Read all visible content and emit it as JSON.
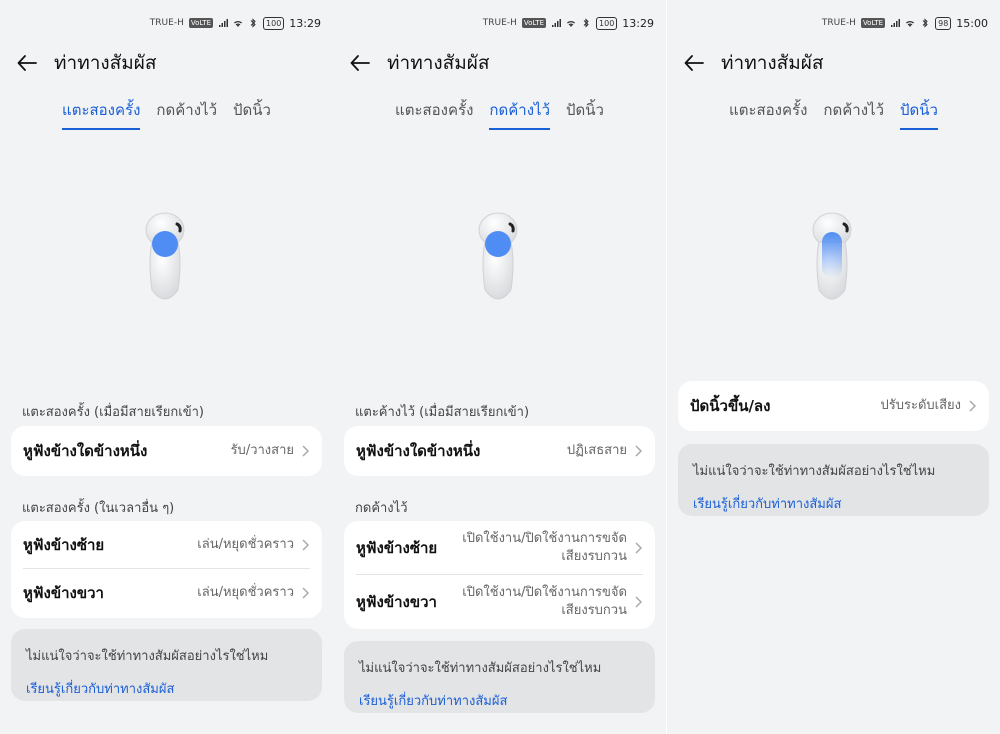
{
  "status": [
    {
      "carrier": "TRUE-H",
      "badge": "VoLTE",
      "battery": "100",
      "time": "13:29"
    },
    {
      "carrier": "TRUE-H",
      "badge": "VoLTE",
      "battery": "100",
      "time": "13:29"
    },
    {
      "carrier": "TRUE-H",
      "badge": "VoLTE",
      "battery": "98",
      "time": "15:00"
    }
  ],
  "title": "ท่าทางสัมผัส",
  "tabs": [
    "แตะสองครั้ง",
    "กดค้างไว้",
    "ปัดนิ้ว"
  ],
  "screen1": {
    "section1": "แตะสองครั้ง (เมื่อมีสายเรียกเข้า)",
    "row1": {
      "label": "หูฟังข้างใดข้างหนึ่ง",
      "value": "รับ/วางสาย"
    },
    "section2": "แตะสองครั้ง (ในเวลาอื่น ๆ)",
    "row2": {
      "label": "หูฟังข้างซ้าย",
      "value": "เล่น/หยุดชั่วคราว"
    },
    "row3": {
      "label": "หูฟังข้างขวา",
      "value": "เล่น/หยุดชั่วคราว"
    }
  },
  "screen2": {
    "section1": "แตะค้างไว้ (เมื่อมีสายเรียกเข้า)",
    "row1": {
      "label": "หูฟังข้างใดข้างหนึ่ง",
      "value": "ปฏิเสธสาย"
    },
    "section2": "กดค้างไว้",
    "row2": {
      "label": "หูฟังข้างซ้าย",
      "value_line1": "เปิดใช้งาน/ปิดใช้งานการขจัด",
      "value_line2": "เสียงรบกวน"
    },
    "row3": {
      "label": "หูฟังข้างขวา",
      "value_line1": "เปิดใช้งาน/ปิดใช้งานการขจัด",
      "value_line2": "เสียงรบกวน"
    }
  },
  "screen3": {
    "row1": {
      "label": "ปัดนิ้วขึ้น/ลง",
      "value": "ปรับระดับเสียง"
    }
  },
  "help": {
    "text": "ไม่แน่ใจว่าจะใช้ท่าทางสัมผัสอย่างไรใช่ไหม",
    "link": "เรียนรู้เกี่ยวกับท่าทางสัมผัส"
  },
  "icons": {
    "back": "back-arrow-icon",
    "chevron": "chevron-right-icon",
    "earbud": "earbud-illustration"
  },
  "colors": {
    "accent": "#1a5fd6",
    "touch": "#4f8df5",
    "background": "#f1f3f5",
    "card": "#ffffff",
    "help_card": "#e3e4e6"
  }
}
